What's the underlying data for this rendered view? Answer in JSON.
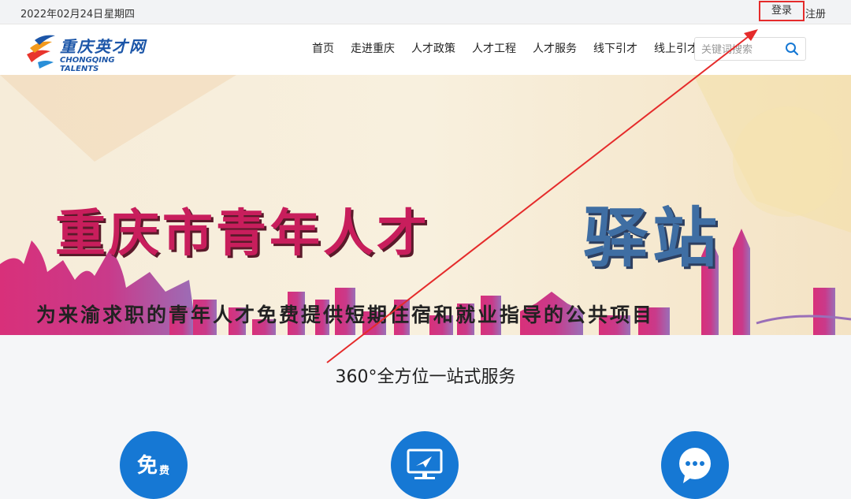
{
  "topbar": {
    "date": "2022年02月24日",
    "weekday": "星期四",
    "login_label": "登录",
    "register_label": "注册"
  },
  "header": {
    "logo": {
      "brand_cn": "重庆英才网",
      "brand_en": "CHONGQING TALENTS"
    },
    "nav": [
      "首页",
      "走进重庆",
      "人才政策",
      "人才工程",
      "人才服务",
      "线下引才",
      "线上引才"
    ],
    "search": {
      "placeholder": "关键词搜索",
      "value": ""
    }
  },
  "banner": {
    "title": "重庆市青年人才",
    "title_highlight": "驿站",
    "subtitle": "为来渝求职的青年人才免费提供短期住宿和就业指导的公共项目"
  },
  "services": {
    "title": "360°全方位一站式服务",
    "items": [
      {
        "icon": "free-icon",
        "text": "免",
        "text_small": "费"
      },
      {
        "icon": "monitor-icon"
      },
      {
        "icon": "chat-icon"
      }
    ]
  },
  "colors": {
    "accent": "#1678d4",
    "highlight_box": "#e52b2b",
    "brand": "#1c56a8"
  }
}
